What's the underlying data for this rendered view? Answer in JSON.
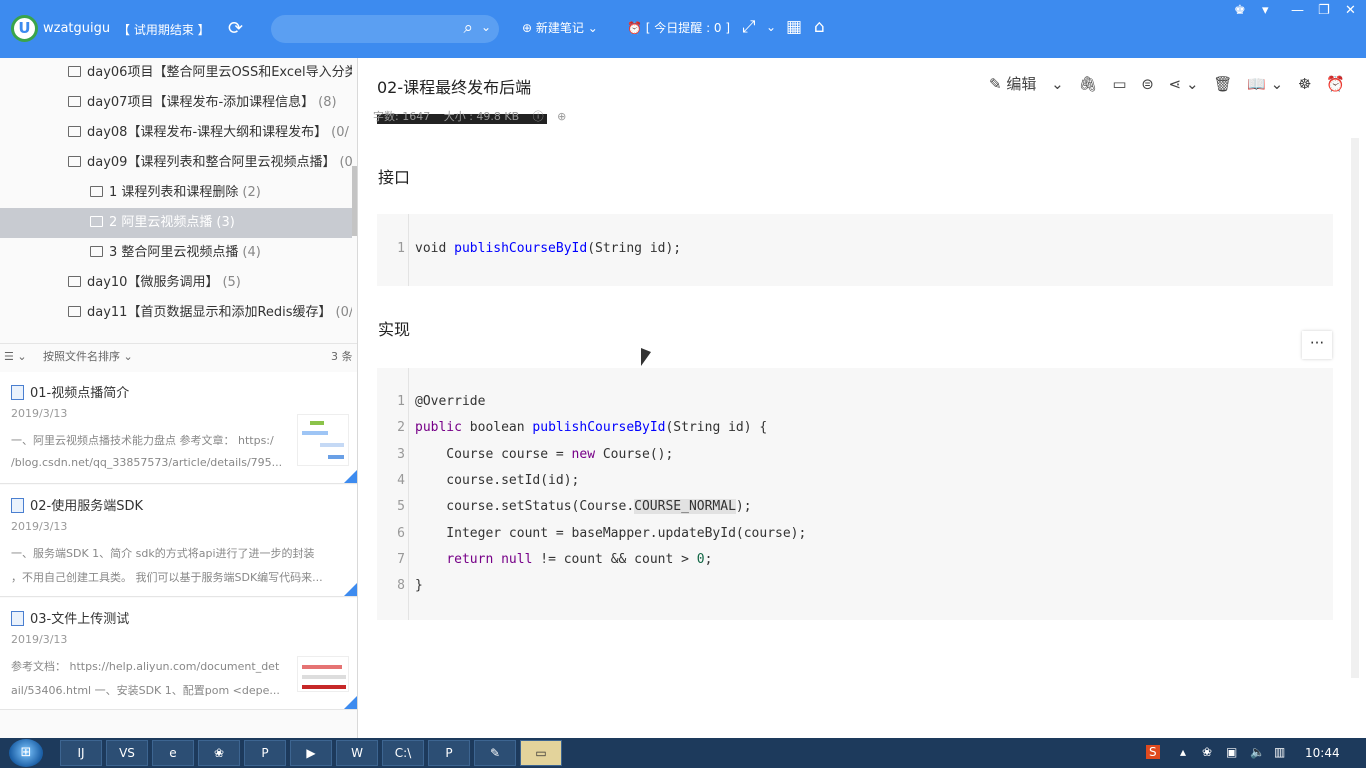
{
  "app": {
    "username": "wzatguigu",
    "trial_badge": "【 试用期结束 】",
    "search_placeholder": "",
    "new_note_label": "新建笔记",
    "reminder_label": "[ 今日提醒 : 0 ]",
    "accent_color": "#3d8bef"
  },
  "sidebar": {
    "tree": [
      {
        "label": "day06项目【整合阿里云OSS和Excel导入分类",
        "count": ""
      },
      {
        "label": "day07项目【课程发布-添加课程信息】",
        "count": "(8)"
      },
      {
        "label": "day08【课程发布-课程大纲和课程发布】",
        "count": "(0/"
      },
      {
        "label": "day09【课程列表和整合阿里云视频点播】",
        "count": "(0"
      },
      {
        "label": "1 课程列表和课程删除",
        "count": "(2)"
      },
      {
        "label": "2 阿里云视频点播",
        "count": "(3)"
      },
      {
        "label": "3 整合阿里云视频点播",
        "count": "(4)"
      },
      {
        "label": "day10【微服务调用】",
        "count": "(5)"
      },
      {
        "label": "day11【首页数据显示和添加Redis缓存】",
        "count": "(0/"
      }
    ],
    "sort_label": "按照文件名排序",
    "note_count": "3 条",
    "notes": [
      {
        "title": "01-视频点播简介",
        "date": "2019/3/13",
        "snippet1": "一、阿里云视频点播技术能力盘点 参考文章： https:/",
        "snippet2": "/blog.csdn.net/qq_33857573/article/details/795..."
      },
      {
        "title": "02-使用服务端SDK",
        "date": "2019/3/13",
        "snippet1": "一、服务端SDK 1、简介 sdk的方式将api进行了进一步的封装",
        "snippet2": "，不用自己创建工具类。 我们可以基于服务端SDK编写代码来..."
      },
      {
        "title": "03-文件上传测试",
        "date": "2019/3/13",
        "snippet1": "参考文档： https://help.aliyun.com/document_det",
        "snippet2": "ail/53406.html 一、安装SDK 1、配置pom <depe..."
      }
    ]
  },
  "document": {
    "title": "02-课程最终发布后端",
    "word_count": "字数: 1647",
    "size": "大小 : 49.8 KB",
    "edit_label": "编辑",
    "section_interface": "接口",
    "section_impl": "实现",
    "interface_code": [
      {
        "n": "1",
        "parts": [
          {
            "t": "void ",
            "c": ""
          },
          {
            "t": "publishCourseById",
            "c": "fn"
          },
          {
            "t": "(String id);",
            "c": ""
          }
        ]
      }
    ],
    "impl_code": [
      {
        "n": "1",
        "parts": [
          {
            "t": "@Override",
            "c": ""
          }
        ]
      },
      {
        "n": "2",
        "parts": [
          {
            "t": "public",
            "c": "kw"
          },
          {
            "t": " boolean ",
            "c": ""
          },
          {
            "t": "publishCourseById",
            "c": "fn"
          },
          {
            "t": "(String id) {",
            "c": ""
          }
        ]
      },
      {
        "n": "3",
        "parts": [
          {
            "t": "    Course course = ",
            "c": ""
          },
          {
            "t": "new",
            "c": "kw"
          },
          {
            "t": " Course();",
            "c": ""
          }
        ]
      },
      {
        "n": "4",
        "parts": [
          {
            "t": "    course.setId(id);",
            "c": ""
          }
        ]
      },
      {
        "n": "5",
        "parts": [
          {
            "t": "    course.setStatus(Course.",
            "c": ""
          },
          {
            "t": "COURSE_NORMAL",
            "c": "hl"
          },
          {
            "t": ");",
            "c": ""
          }
        ]
      },
      {
        "n": "6",
        "parts": [
          {
            "t": "    Integer count = baseMapper.updateById(course);",
            "c": ""
          }
        ]
      },
      {
        "n": "7",
        "parts": [
          {
            "t": "    ",
            "c": ""
          },
          {
            "t": "return",
            "c": "kw"
          },
          {
            "t": " ",
            "c": ""
          },
          {
            "t": "null",
            "c": "kw"
          },
          {
            "t": " != count && count > ",
            "c": ""
          },
          {
            "t": "0",
            "c": "lit"
          },
          {
            "t": ";",
            "c": ""
          }
        ]
      },
      {
        "n": "8",
        "parts": [
          {
            "t": "}",
            "c": ""
          }
        ]
      }
    ],
    "more_button": "···"
  },
  "taskbar": {
    "apps": [
      "IJ",
      "VS",
      "e",
      "❀",
      "P",
      "▶",
      "W",
      "C:\\",
      "P",
      "✎",
      "▭"
    ],
    "clock": "10:44"
  }
}
